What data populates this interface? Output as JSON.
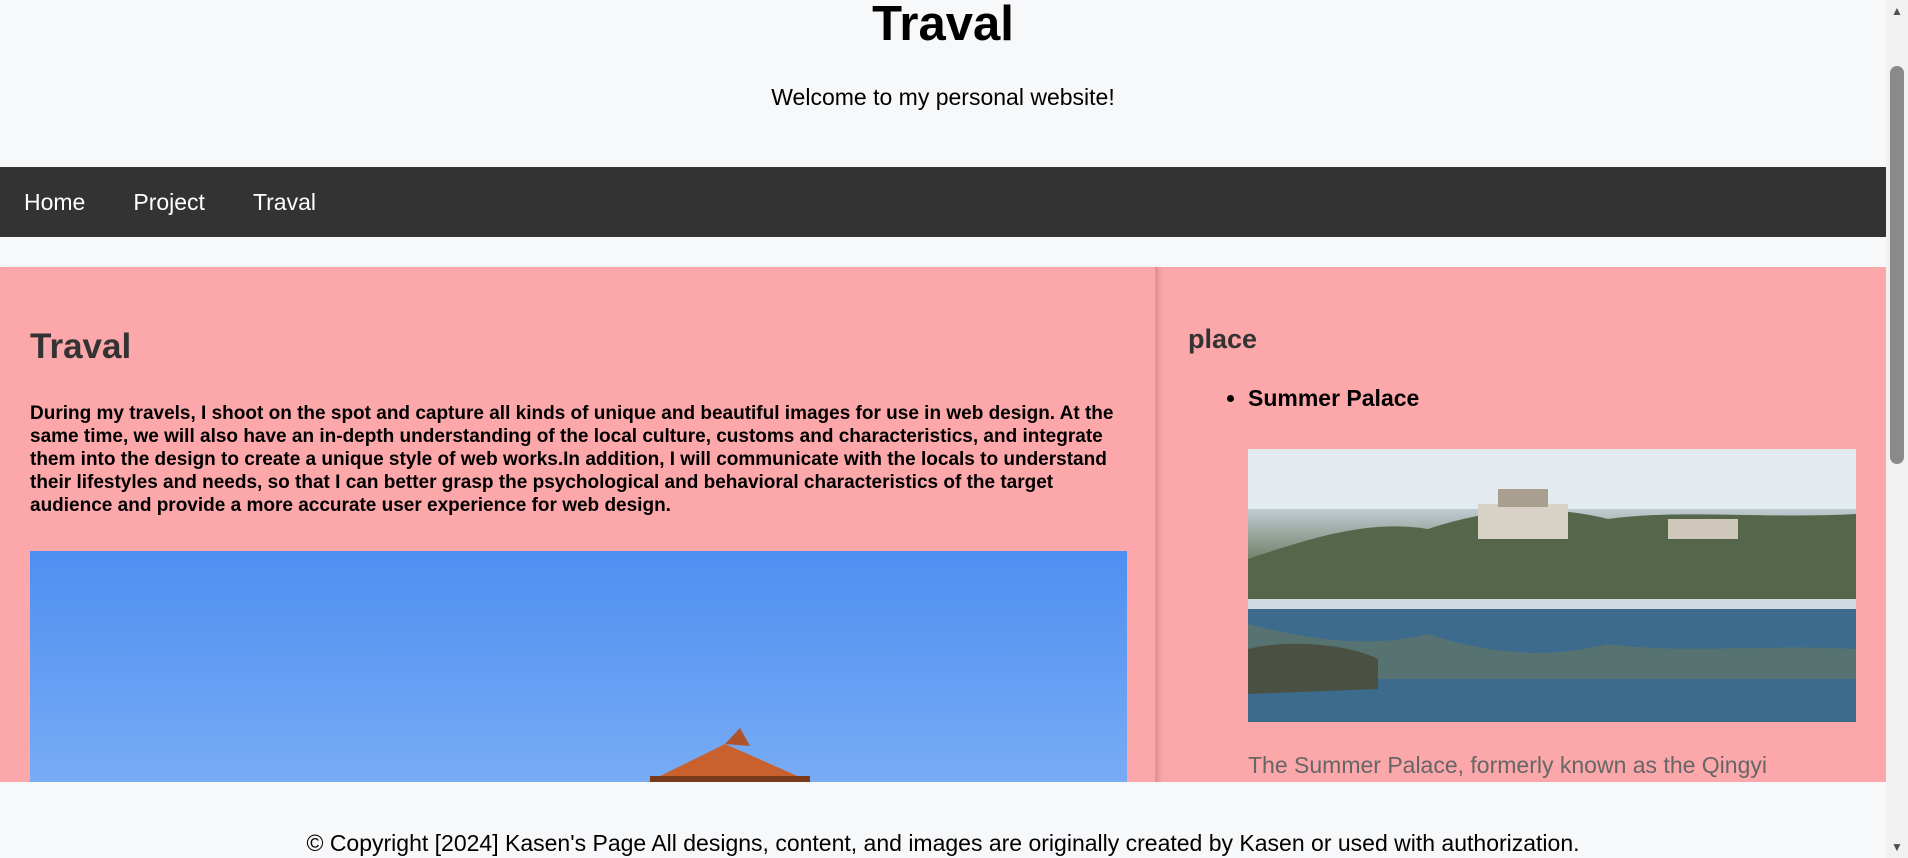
{
  "header": {
    "title": "Traval",
    "tagline": "Welcome to my personal website!"
  },
  "nav": {
    "items": [
      "Home",
      "Project",
      "Traval"
    ]
  },
  "content": {
    "title": "Traval",
    "description": "During my travels, I shoot on the spot and capture all kinds of unique and beautiful images for use in web design. At the same time, we will also have an in-depth understanding of the local culture, customs and characteristics, and integrate them into the design to create a unique style of web works.In addition, I will communicate with the locals to understand their lifestyles and needs, so that I can better grasp the psychological and behavioral characteristics of the target audience and provide a more accurate user experience for web design."
  },
  "sidebar": {
    "title": "place",
    "places": [
      {
        "name": "Summer Palace",
        "description": "The Summer Palace, formerly known as the Qingyi"
      }
    ]
  },
  "footer": {
    "text": "© Copyright [2024] Kasen's Page All designs, content, and images are originally created by Kasen or used with authorization."
  },
  "colors": {
    "nav_bg": "#333333",
    "main_bg": "#fca7a9",
    "page_bg": "#f7f8fa"
  }
}
